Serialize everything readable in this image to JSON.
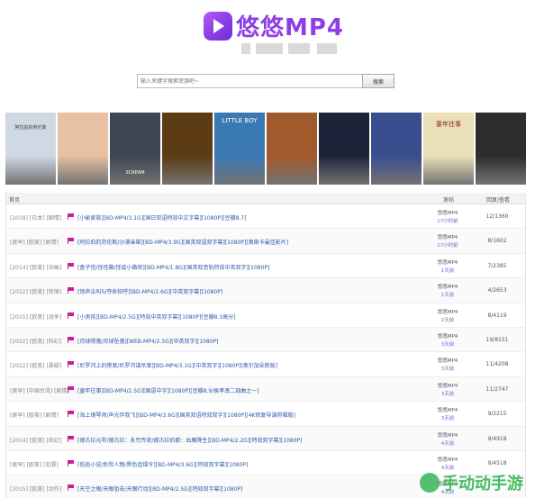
{
  "header": {
    "logo_text": "悠悠MP4"
  },
  "search": {
    "placeholder": "输入关键字搜索资源吧~",
    "button_label": "搜索"
  },
  "posters": [
    {
      "label": "阿拉伯的劳伦斯",
      "bg": "#cfd9e4",
      "fg": "#3a3a3a"
    },
    {
      "label": "",
      "bg": "#e7c1a3",
      "fg": "#ffffff"
    },
    {
      "label": "SCREAM",
      "bg": "#3d4651",
      "fg": "#ffffff"
    },
    {
      "label": "",
      "bg": "#5d3b14",
      "fg": "#f7c143"
    },
    {
      "label": "LITTLE BOY",
      "bg": "#3b79b4",
      "fg": "#ffffff"
    },
    {
      "label": "",
      "bg": "#a15a2b",
      "fg": "#ffffff"
    },
    {
      "label": "",
      "bg": "#1b2438",
      "fg": "#ffffff"
    },
    {
      "label": "",
      "bg": "#3a4e8f",
      "fg": "#ffffff"
    },
    {
      "label": "童年往事",
      "bg": "#e9e0b9",
      "fg": "#8a2020"
    },
    {
      "label": "",
      "bg": "#2d2d2d",
      "fg": "#ffffff"
    }
  ],
  "table": {
    "headers": {
      "title": "首页",
      "author": "发帖",
      "stats": "回复/查看"
    },
    "rows": [
      {
        "category": "[2018] [日本] [剧情]",
        "title": "[小偷家族][BD-MP4/3.1G][国日双语特效中文字幕][1080P][豆瓣8.7]",
        "author": "悠悠MP4",
        "time": "17小时前",
        "stats": "12/1360"
      },
      {
        "category": "[更早] [欧美] [剧情]",
        "title": "[阿拉伯的劳伦斯/沙漠枭雄][BD-MP4/3.9G][国英双语双字幕][1080P][奥斯卡最佳影片]",
        "author": "悠悠MP4",
        "time": "17小时前",
        "stats": "8/1602"
      },
      {
        "category": "[2014] [欧美] [动画]",
        "title": "[盒子怪/怪怪箱/怪诞小箱侠][BD-MP4/1.8G][国英双音轨特效中英双字][1080P]",
        "author": "悠悠MP4",
        "time": "1天前",
        "stats": "7/2385"
      },
      {
        "category": "[2022] [欧美] [惊悚]",
        "title": "[惊声尖叫5/夺命狂呼][BD-MP4/2.6G][中英双字幕][1080P]",
        "author": "悠悠MP4",
        "time": "1天前",
        "stats": "4/2653"
      },
      {
        "category": "[2015] [欧美] [战争]",
        "title": "[小男孩][BD-MP4/2.5G][特效中英双字幕][1080P][豆瓣8.3高分]",
        "author": "悠悠MP4",
        "time": "2天前",
        "stats": "8/4119"
      },
      {
        "category": "[2022] [欧美] [科幻]",
        "title": "[月球陨落/月球坠落][WEB-MP4/2.5G][中英双字][1080P]",
        "author": "悠悠MP4",
        "time": "3天前",
        "stats": "19/8151"
      },
      {
        "category": "[2022] [欧美] [悬疑]",
        "title": "[尼罗河上的惨案/尼罗河谋杀案][BD-MP4/3.1G][中英双字][1080P][奥尔加朵新版]",
        "author": "悠悠MP4",
        "time": "3天前",
        "stats": "11/4208"
      },
      {
        "category": "[更早] [中国台湾] [剧情]",
        "title": "[童年往事][BD-MP4/2.5G][国语中字][1080P][豆瓣8.9/侯孝贤二部曲之一]",
        "author": "悠悠MP4",
        "time": "3天前",
        "stats": "11/2747"
      },
      {
        "category": "[更早] [欧美] [剧情]",
        "title": "[海上钢琴师/声光伴我飞][BD-MP4/3.6G][国英双语特效双字][1080P][4K修复导演剪辑版]",
        "author": "悠悠MP4",
        "time": "3天前",
        "stats": "9/2215"
      },
      {
        "category": "[2014] [欧美] [奇幻]",
        "title": "[德古拉元年/德古拉：永咒传奇/德古拉伯爵：血魔降生][BD-MP4/2.2G][特效双字幕][1080P]",
        "author": "悠悠MP4",
        "time": "4天前",
        "stats": "9/4918"
      },
      {
        "category": "[更早] [欧美] [犯罪]",
        "title": "[低俗小说/危险人物/黑色追缉令][BD-MP4/3.6G][特效双字幕][1080P]",
        "author": "悠悠MP4",
        "time": "4天前",
        "stats": "9/4518"
      },
      {
        "category": "[2015] [欧美] [动作]",
        "title": "[天空之眼/天眼狙击/天眼行动][BD-MP4/2.5G][特效双字幕][1080P]",
        "author": "悠悠MP4",
        "time": "4天前",
        "stats": ""
      }
    ]
  },
  "watermark": {
    "text": "手动动手游"
  }
}
